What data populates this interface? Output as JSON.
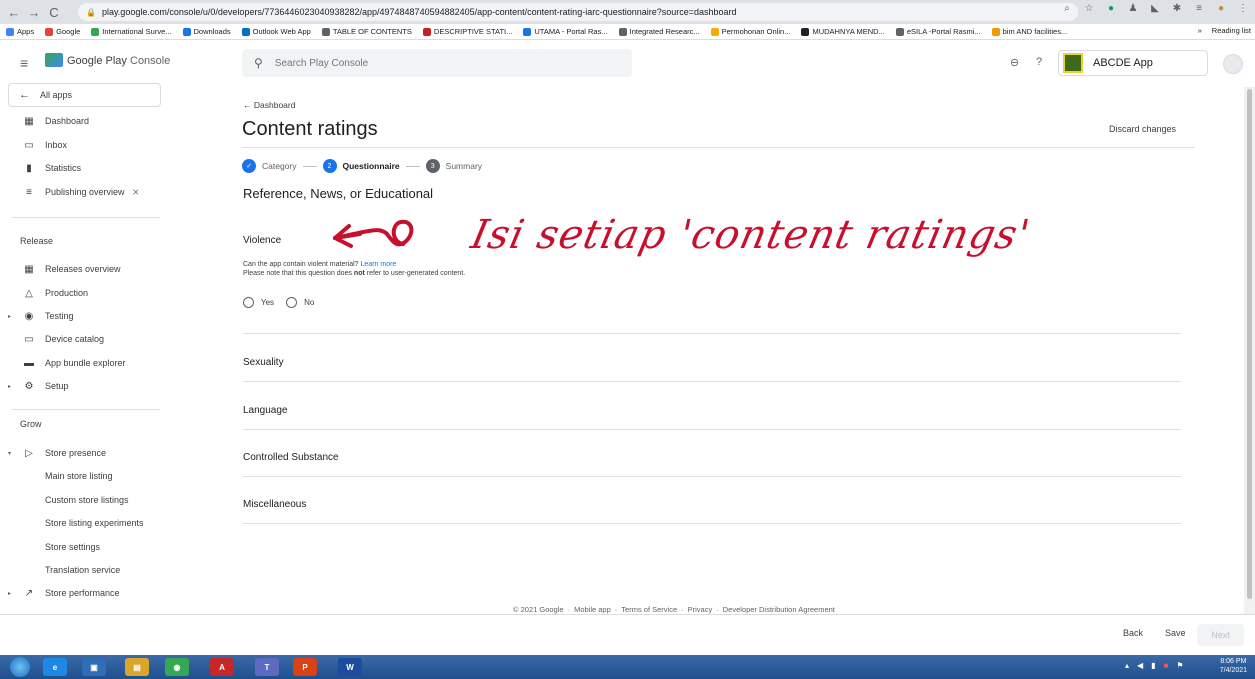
{
  "browser": {
    "url": "play.google.com/console/u/0/developers/7736446023040938282/app/4974848740594882405/app-content/content-rating-iarc-questionnaire?source=dashboard",
    "bookmarks": [
      "Apps",
      "Google",
      "International Surve...",
      "Downloads",
      "Outlook Web App",
      "TABLE OF CONTENTS",
      "DESCRIPTIVE STATI...",
      "UTAMA - Portal Ras...",
      "Integrated Researc...",
      "Permohonan Onlin...",
      "MUDAHNYA MEND...",
      "eSILA -Portal Rasmi...",
      "bim AND facilities..."
    ],
    "bookmark_colors": [
      "#4285f4",
      "#ea4335",
      "#34a853",
      "#1a73e8",
      "#0072c6",
      "#5f6368",
      "#c5221f",
      "#1a73e8",
      "#5f6368",
      "#f9ab00",
      "#202124",
      "#5f6368",
      "#f29900"
    ],
    "more_label": "»",
    "reading_list": "Reading list"
  },
  "header": {
    "product_name": "Google Play",
    "product_suffix": "Console",
    "search_placeholder": "Search Play Console",
    "app_name": "ABCDE App"
  },
  "sidebar": {
    "all_apps": "All apps",
    "top_items": [
      {
        "label": "Dashboard",
        "icon": "dashboard-icon",
        "glyph": "▦"
      },
      {
        "label": "Inbox",
        "icon": "inbox-icon",
        "glyph": "▭"
      },
      {
        "label": "Statistics",
        "icon": "statistics-icon",
        "glyph": "▮"
      },
      {
        "label": "Publishing overview",
        "icon": "publishing-icon",
        "glyph": "≡",
        "extra_icon": "⨯"
      }
    ],
    "release_label": "Release",
    "release_items": [
      {
        "label": "Releases overview",
        "glyph": "▦"
      },
      {
        "label": "Production",
        "glyph": "△"
      },
      {
        "label": "Testing",
        "glyph": "◉"
      },
      {
        "label": "Device catalog",
        "glyph": "▭"
      },
      {
        "label": "App bundle explorer",
        "glyph": "▬"
      },
      {
        "label": "Setup",
        "glyph": "⚙"
      }
    ],
    "grow_label": "Grow",
    "grow_items": [
      {
        "label": "Store presence",
        "glyph": "▷"
      },
      {
        "label": "Main store listing"
      },
      {
        "label": "Custom store listings"
      },
      {
        "label": "Store listing experiments"
      },
      {
        "label": "Store settings"
      },
      {
        "label": "Translation service"
      },
      {
        "label": "Store performance",
        "glyph": "↗"
      }
    ]
  },
  "main": {
    "back_label": "Dashboard",
    "title": "Content ratings",
    "discard": "Discard changes",
    "steps": [
      {
        "num": "✓",
        "label": "Category",
        "state": "done"
      },
      {
        "num": "2",
        "label": "Questionnaire",
        "state": "active"
      },
      {
        "num": "3",
        "label": "Summary",
        "state": "pending"
      }
    ],
    "section_title": "Reference, News, or Educational",
    "question": {
      "title": "Violence",
      "desc_1": "Can the app contain violent material?",
      "learn_more": "Learn more",
      "desc_2a": "Please note that this question does",
      "desc_2b": "not",
      "desc_2c": "refer to user-generated content.",
      "options": [
        "Yes",
        "No"
      ]
    },
    "accordions": [
      "Sexuality",
      "Language",
      "Controlled Substance",
      "Miscellaneous"
    ],
    "footer": [
      "© 2021 Google",
      "Mobile app",
      "Terms of Service",
      "Privacy",
      "Developer Distribution Agreement"
    ]
  },
  "actions": {
    "back": "Back",
    "save": "Save",
    "next": "Next"
  },
  "annotation": "Isi setiap 'content ratings'",
  "taskbar": {
    "apps": [
      {
        "glyph": "e",
        "color": "#1e88e5"
      },
      {
        "glyph": "▣",
        "color": "#2f6db5"
      },
      {
        "glyph": "▤",
        "color": "#d9a62b"
      },
      {
        "glyph": "◉",
        "color": "#34a853"
      },
      {
        "glyph": "A",
        "color": "#c62828"
      },
      {
        "glyph": "T",
        "color": "#5c6bc0"
      },
      {
        "glyph": "P",
        "color": "#d84315"
      },
      {
        "glyph": "W",
        "color": "#1e4c9c"
      }
    ],
    "time": "8:06 PM",
    "date": "7/4/2021"
  }
}
